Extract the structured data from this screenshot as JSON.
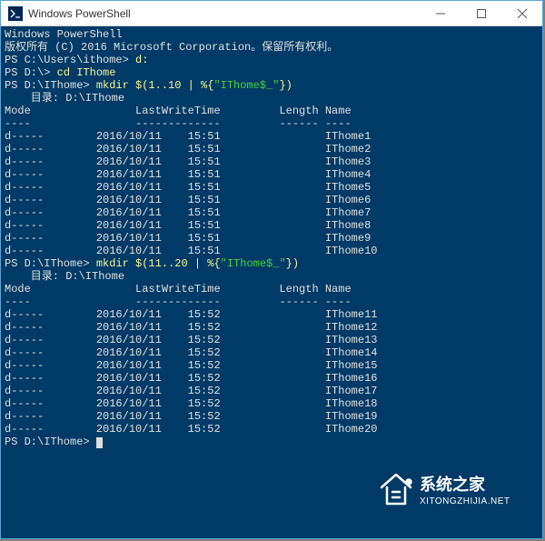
{
  "window": {
    "title": "Windows PowerShell"
  },
  "header": {
    "line1": "Windows PowerShell",
    "line2": "版权所有 (C) 2016 Microsoft Corporation。保留所有权利。"
  },
  "cmd1": {
    "prompt": "PS C:\\Users\\ithome>",
    "text": " d:"
  },
  "cmd2": {
    "prompt": "PS D:\\>",
    "text": " cd IThome"
  },
  "cmd3": {
    "prompt": "PS D:\\IThome>",
    "text_a": " mkdir $(1..10 | %{",
    "quoted": "\"IThome$_\"",
    "text_b": "})"
  },
  "dir1_label": "    目录: D:\\IThome",
  "table_headers": {
    "mode": "Mode",
    "lastwrite": "LastWriteTime",
    "length": "Length",
    "name": "Name"
  },
  "rows1": [
    {
      "mode": "d-----",
      "date": "2016/10/11",
      "time": "15:51",
      "name": "IThome1"
    },
    {
      "mode": "d-----",
      "date": "2016/10/11",
      "time": "15:51",
      "name": "IThome2"
    },
    {
      "mode": "d-----",
      "date": "2016/10/11",
      "time": "15:51",
      "name": "IThome3"
    },
    {
      "mode": "d-----",
      "date": "2016/10/11",
      "time": "15:51",
      "name": "IThome4"
    },
    {
      "mode": "d-----",
      "date": "2016/10/11",
      "time": "15:51",
      "name": "IThome5"
    },
    {
      "mode": "d-----",
      "date": "2016/10/11",
      "time": "15:51",
      "name": "IThome6"
    },
    {
      "mode": "d-----",
      "date": "2016/10/11",
      "time": "15:51",
      "name": "IThome7"
    },
    {
      "mode": "d-----",
      "date": "2016/10/11",
      "time": "15:51",
      "name": "IThome8"
    },
    {
      "mode": "d-----",
      "date": "2016/10/11",
      "time": "15:51",
      "name": "IThome9"
    },
    {
      "mode": "d-----",
      "date": "2016/10/11",
      "time": "15:51",
      "name": "IThome10"
    }
  ],
  "cmd4": {
    "prompt": "PS D:\\IThome>",
    "text_a": " mkdir $(11..20 | %{",
    "quoted": "\"IThome$_\"",
    "text_b": "})"
  },
  "dir2_label": "    目录: D:\\IThome",
  "rows2": [
    {
      "mode": "d-----",
      "date": "2016/10/11",
      "time": "15:52",
      "name": "IThome11"
    },
    {
      "mode": "d-----",
      "date": "2016/10/11",
      "time": "15:52",
      "name": "IThome12"
    },
    {
      "mode": "d-----",
      "date": "2016/10/11",
      "time": "15:52",
      "name": "IThome13"
    },
    {
      "mode": "d-----",
      "date": "2016/10/11",
      "time": "15:52",
      "name": "IThome14"
    },
    {
      "mode": "d-----",
      "date": "2016/10/11",
      "time": "15:52",
      "name": "IThome15"
    },
    {
      "mode": "d-----",
      "date": "2016/10/11",
      "time": "15:52",
      "name": "IThome16"
    },
    {
      "mode": "d-----",
      "date": "2016/10/11",
      "time": "15:52",
      "name": "IThome17"
    },
    {
      "mode": "d-----",
      "date": "2016/10/11",
      "time": "15:52",
      "name": "IThome18"
    },
    {
      "mode": "d-----",
      "date": "2016/10/11",
      "time": "15:52",
      "name": "IThome19"
    },
    {
      "mode": "d-----",
      "date": "2016/10/11",
      "time": "15:52",
      "name": "IThome20"
    }
  ],
  "cmd5": {
    "prompt": "PS D:\\IThome>",
    "text": " "
  },
  "watermark": {
    "cn": "系统之家",
    "en": "XITONGZHIJIA.NET"
  }
}
